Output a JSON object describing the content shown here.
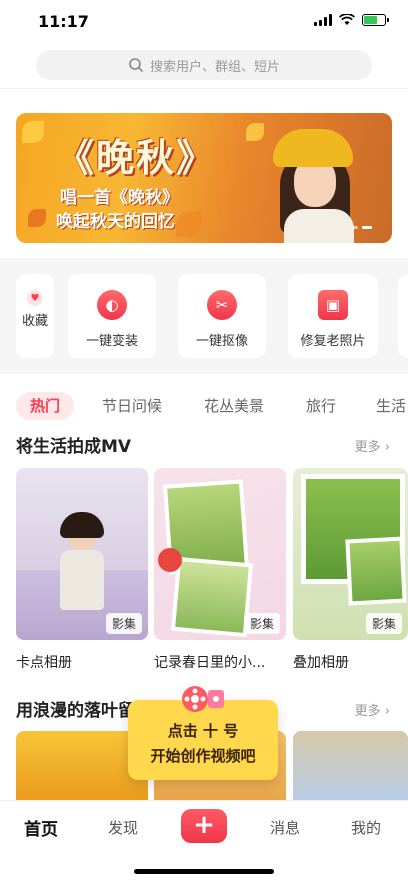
{
  "status": {
    "time": "11:17"
  },
  "search": {
    "placeholder": "搜索用户、群组、短片"
  },
  "banner": {
    "title": "《晚秋》",
    "line1": "唱一首《晚秋》",
    "line2": "唤起秋天的回忆"
  },
  "toolbox": {
    "favorites_label": "收藏",
    "items": [
      {
        "label": "一键变装",
        "icon": "mask-icon"
      },
      {
        "label": "一键抠像",
        "icon": "scissors-icon"
      },
      {
        "label": "修复老照片",
        "icon": "photo-icon"
      }
    ]
  },
  "tabs": [
    "热门",
    "节日问候",
    "花丛美景",
    "旅行",
    "生活"
  ],
  "section1": {
    "title": "将生活拍成MV",
    "more": "更多",
    "cards": [
      {
        "label": "卡点相册",
        "badge": "影集"
      },
      {
        "label": "记录春日里的小...",
        "badge": "影集"
      },
      {
        "label": "叠加相册",
        "badge": "影集"
      }
    ]
  },
  "section2": {
    "title": "用浪漫的落叶留住秋天",
    "more": "更多"
  },
  "tooltip": {
    "line1": "点击 十 号",
    "line2": "开始创作视频吧"
  },
  "nav": {
    "home": "首页",
    "discover": "发现",
    "plus": "+",
    "messages": "消息",
    "me": "我的"
  }
}
